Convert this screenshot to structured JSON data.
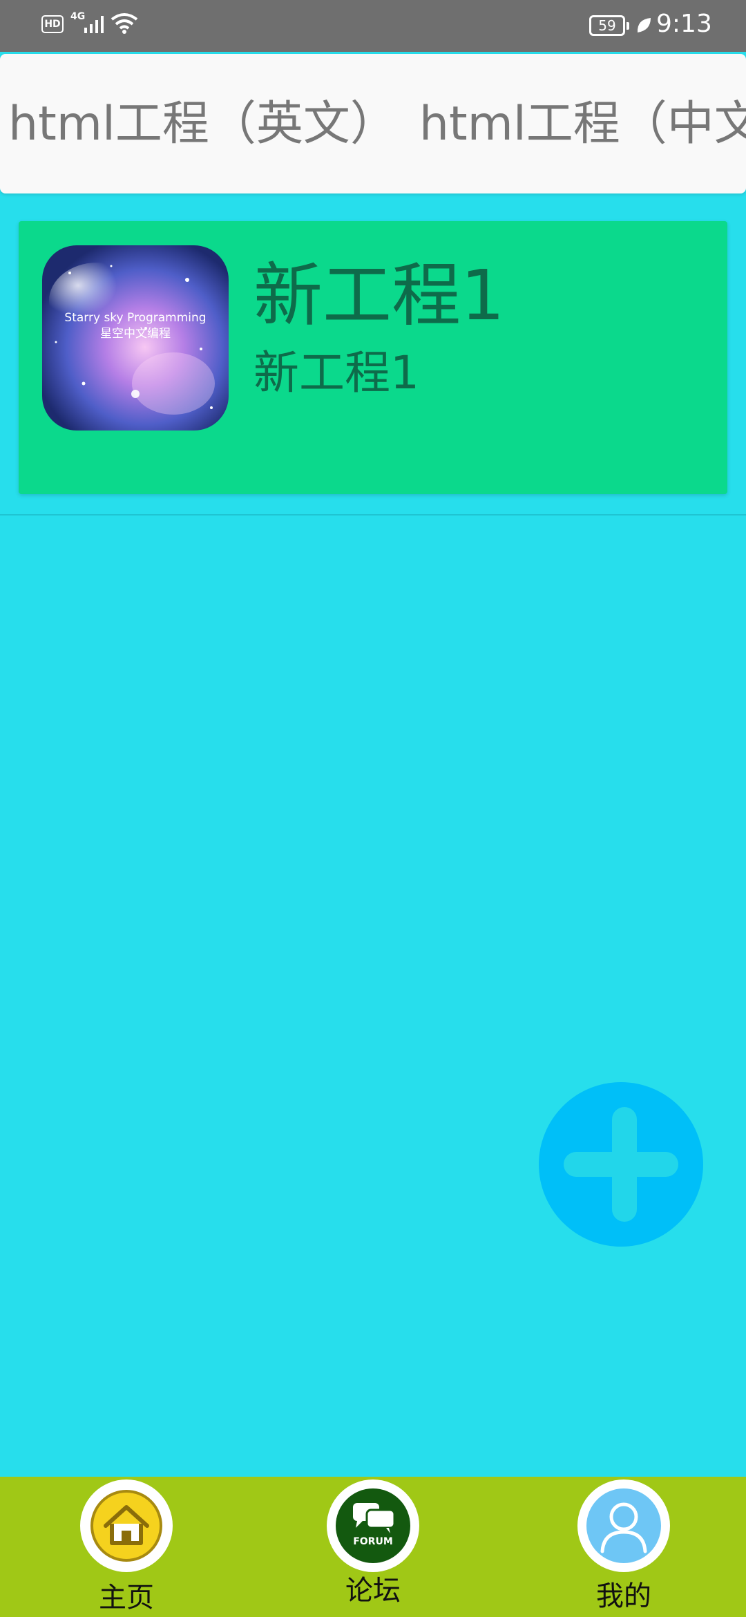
{
  "status_bar": {
    "hd": "HD",
    "network": "4G",
    "battery": "59",
    "time": "9:13"
  },
  "tabs": [
    {
      "label": "html工程（英文）"
    },
    {
      "label": "html工程（中文）"
    }
  ],
  "project": {
    "title": "新工程1",
    "subtitle": "新工程1",
    "thumb_text_en": "Starry sky Programming",
    "thumb_text_cn": "星空中文编程"
  },
  "fab": {
    "icon": "plus-icon"
  },
  "bottom_nav": {
    "home": {
      "label": "主页",
      "icon": "home-icon"
    },
    "forum": {
      "label": "论坛",
      "icon": "forum-icon",
      "badge": "FORUM"
    },
    "mine": {
      "label": "我的",
      "icon": "user-icon"
    }
  },
  "colors": {
    "background": "#27deec",
    "card": "#0bd98c",
    "fab": "#00bff8",
    "bottom_nav": "#a0c816"
  }
}
